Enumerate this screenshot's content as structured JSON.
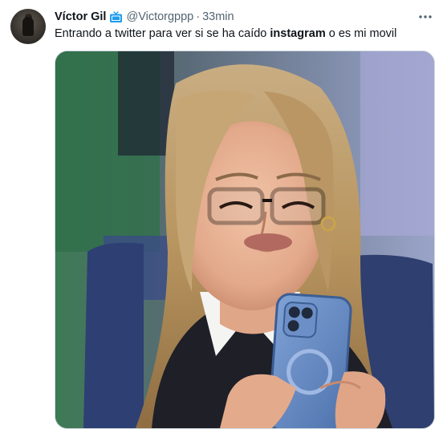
{
  "tweet": {
    "author_name": "Víctor Gil",
    "handle": "@Victorgppp",
    "separator": "·",
    "time": "33min",
    "text_before": "Entrando a twitter para ver si se ha caído ",
    "text_bold": "instagram",
    "text_after": " o es mi movil"
  },
  "icons": {
    "badge": "tv-icon",
    "menu": "more-options-icon"
  },
  "colors": {
    "secondary_text": "#536471",
    "badge_blue": "#1d9bf0",
    "border": "#cfd9de"
  }
}
